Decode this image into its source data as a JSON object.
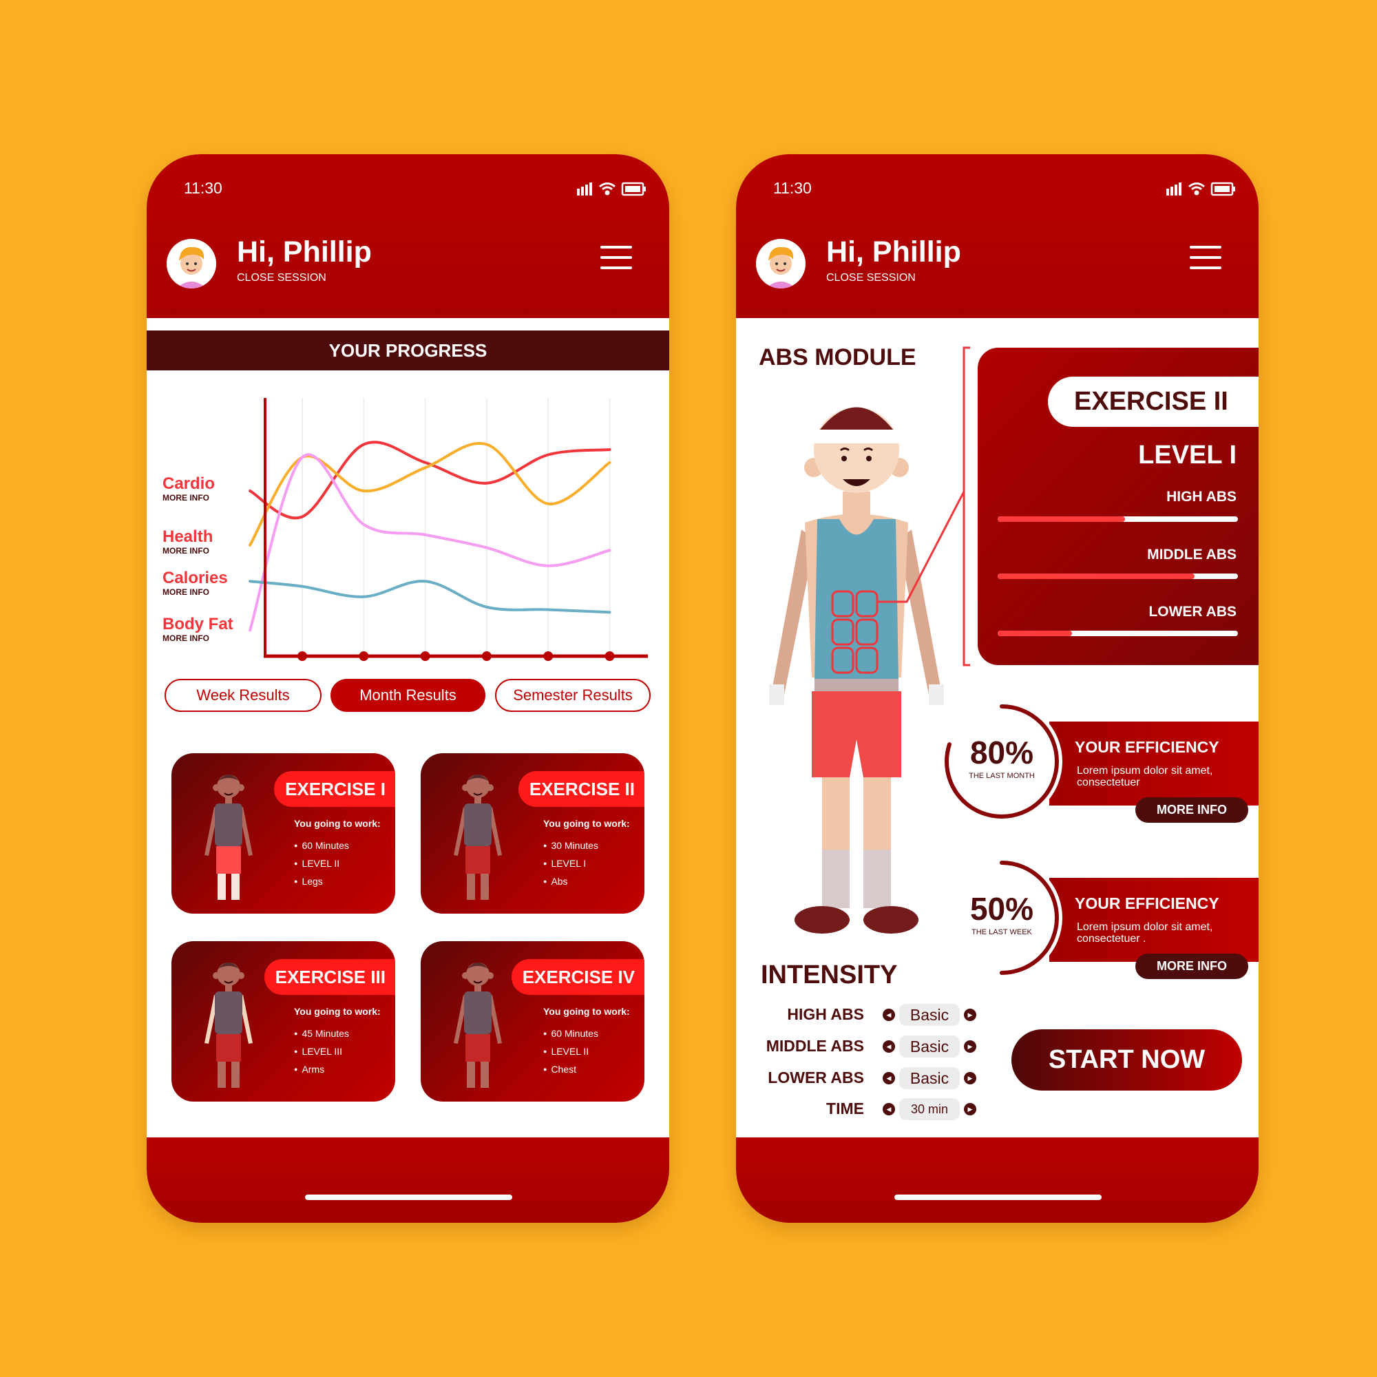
{
  "colors": {
    "background": "#fdb022",
    "header": "#b80000",
    "dark": "#4f0c0c",
    "accent": "#ff1a1a"
  },
  "left_phone": {
    "status": {
      "time": "11:30",
      "icons": [
        "signal-icon",
        "wifi-icon",
        "battery-icon"
      ]
    },
    "header": {
      "greeting": "Hi, Phillip",
      "subtitle": "CLOSE SESSION"
    },
    "progress": {
      "title": "YOUR PROGRESS",
      "legend": [
        {
          "label": "Cardio",
          "more": "MORE INFO"
        },
        {
          "label": "Health",
          "more": "MORE INFO"
        },
        {
          "label": "Calories",
          "more": "MORE INFO"
        },
        {
          "label": "Body Fat",
          "more": "MORE INFO"
        }
      ],
      "buttons": [
        {
          "label": "Week Results",
          "active": false
        },
        {
          "label": "Month Results",
          "active": true
        },
        {
          "label": "Semester Results",
          "active": false
        }
      ]
    },
    "exercises": [
      {
        "title": "EXERCISE I",
        "intro": "You going to work:",
        "items": [
          "60 Minutes",
          "LEVEL II",
          "Legs"
        ],
        "shirt": "#6b5560",
        "highlight": "legs"
      },
      {
        "title": "EXERCISE II",
        "intro": "You going to work:",
        "items": [
          "30 Minutes",
          "LEVEL I",
          "Abs"
        ],
        "shirt": "#6b5560",
        "highlight": "abs"
      },
      {
        "title": "EXERCISE III",
        "intro": "You going to work:",
        "items": [
          "45 Minutes",
          "LEVEL III",
          "Arms"
        ],
        "shirt": "#6b5560",
        "highlight": "arms"
      },
      {
        "title": "EXERCISE IV",
        "intro": "You going to work:",
        "items": [
          "60 Minutes",
          "LEVEL II",
          "Chest"
        ],
        "shirt": "#6b5560",
        "highlight": "chest"
      }
    ]
  },
  "chart_data": {
    "type": "line",
    "x": [
      0.15,
      1,
      2,
      3,
      4,
      5,
      6
    ],
    "xticks": [
      1,
      2,
      3,
      4,
      5,
      6
    ],
    "xlim": [
      0.4,
      6.6
    ],
    "ylim": [
      0,
      100
    ],
    "grid": "vertical",
    "legend": "left",
    "series": [
      {
        "color": "#f0353b",
        "values": [
          64,
          54,
          82,
          75,
          67,
          78,
          80
        ]
      },
      {
        "color": "#f9ae2b",
        "values": [
          43,
          77,
          64,
          73,
          82,
          59,
          75
        ]
      },
      {
        "color": "#f59df0",
        "values": [
          10,
          77,
          51,
          47,
          42,
          35,
          41
        ]
      },
      {
        "color": "#6aaec6",
        "values": [
          29,
          27,
          23,
          29,
          19,
          18,
          17
        ]
      }
    ]
  },
  "right_phone": {
    "status": {
      "time": "11:30",
      "icons": [
        "signal-icon",
        "wifi-icon",
        "battery-icon"
      ]
    },
    "header": {
      "greeting": "Hi, Phillip",
      "subtitle": "CLOSE SESSION"
    },
    "module_title": "ABS MODULE",
    "exercise_title": "EXERCISE II",
    "level": "LEVEL I",
    "bars": [
      {
        "label": "HIGH ABS",
        "value": 0.53
      },
      {
        "label": "MIDDLE ABS",
        "value": 0.82
      },
      {
        "label": "LOWER ABS",
        "value": 0.31
      }
    ],
    "efficiency": [
      {
        "percent": "80%",
        "value": 0.8,
        "period": "THE LAST MONTH",
        "title": "YOUR EFFICIENCY",
        "text": "Lorem ipsum dolor sit amet, consectetuer",
        "more": "MORE INFO"
      },
      {
        "percent": "50%",
        "value": 0.5,
        "period": "THE LAST WEEK",
        "title": "YOUR EFFICIENCY",
        "text": "Lorem ipsum dolor sit amet, consectetuer .",
        "more": "MORE INFO"
      }
    ],
    "intensity": {
      "title": "INTENSITY",
      "rows": [
        {
          "label": "HIGH ABS",
          "value": "Basic"
        },
        {
          "label": "MIDDLE ABS",
          "value": "Basic"
        },
        {
          "label": "LOWER ABS",
          "value": "Basic"
        },
        {
          "label": "TIME",
          "value": "30 min"
        }
      ]
    },
    "start_label": "START NOW"
  }
}
